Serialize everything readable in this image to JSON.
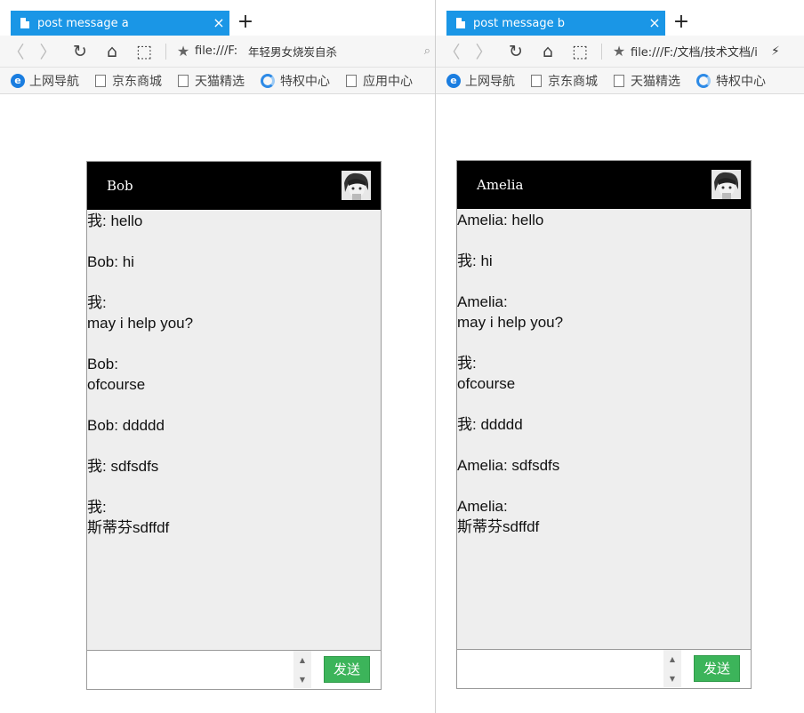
{
  "windows": [
    {
      "tab_title": "post message a",
      "tab_close": "×",
      "new_tab": "+",
      "url": "file:///F:",
      "suggest": "年轻男女烧炭自杀",
      "bookmarks": [
        "上网导航",
        "京东商城",
        "天猫精选",
        "特权中心",
        "应用中心"
      ],
      "chat": {
        "header_name": "Bob",
        "messages": [
          "我: hello",
          "Bob: hi",
          "我:\nmay i help you?",
          "Bob:\nofcourse",
          "Bob: ddddd\n",
          "我: sdfsdfs",
          "我:\n斯蒂芬sdffdf"
        ],
        "send_label": "发送"
      }
    },
    {
      "tab_title": "post message b",
      "tab_close": "×",
      "new_tab": "+",
      "url": "file:///F:/文档/技术文档/i",
      "bookmarks": [
        "上网导航",
        "京东商城",
        "天猫精选",
        "特权中心"
      ],
      "chat": {
        "header_name": "Amelia",
        "messages": [
          "Amelia: hello",
          "我: hi",
          "Amelia:\nmay i help you?",
          "我:\nofcourse",
          "我: ddddd\n",
          "Amelia: sdfsdfs",
          "Amelia:\n斯蒂芬sdffdf"
        ],
        "send_label": "发送"
      }
    }
  ],
  "colors": {
    "tab_active": "#1a96e6",
    "send_button": "#3cb45a",
    "chat_header": "#000000",
    "chat_bg": "#eeeeee"
  }
}
